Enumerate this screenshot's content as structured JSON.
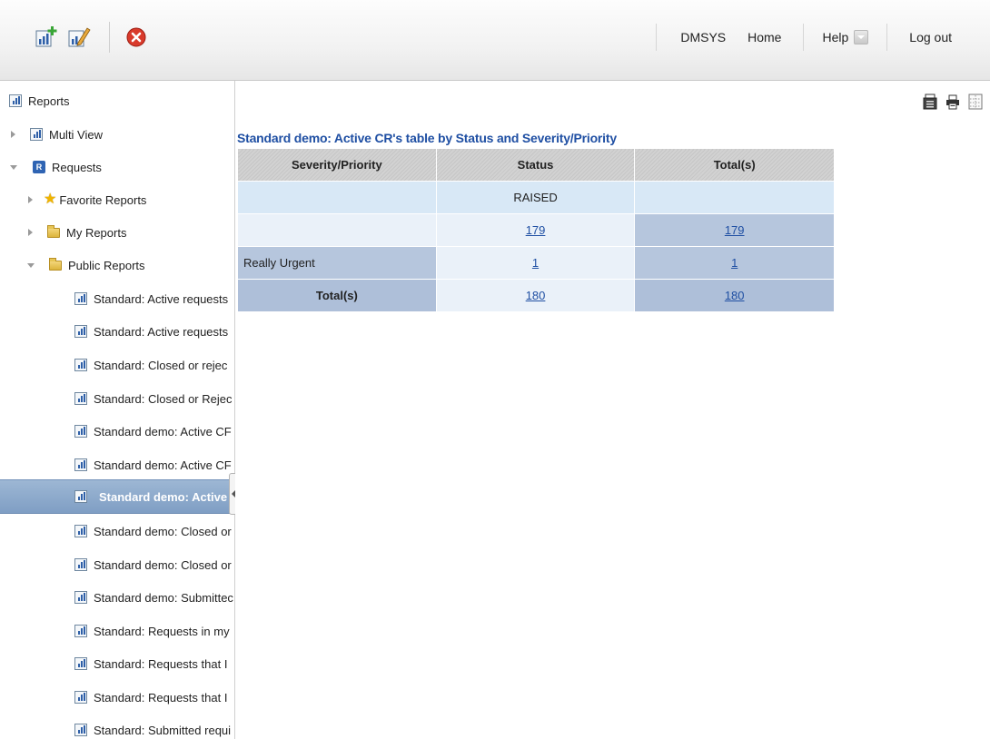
{
  "toolbar": {
    "icons": [
      "new-report-icon",
      "edit-report-icon",
      "delete-icon"
    ]
  },
  "nav": {
    "user": "DMSYS",
    "home": "Home",
    "help": "Help",
    "logout": "Log out"
  },
  "tree": {
    "reports": "Reports",
    "multi_view": "Multi View",
    "requests": "Requests",
    "requests_icon_letter": "R",
    "favorite_reports": "Favorite Reports",
    "my_reports": "My Reports",
    "public_reports": "Public Reports",
    "items": [
      {
        "label": "Standard: Active requests"
      },
      {
        "label": "Standard: Active requests"
      },
      {
        "label": "Standard: Closed or rejec"
      },
      {
        "label": "Standard: Closed or Rejec"
      },
      {
        "label": "Standard demo: Active CF"
      },
      {
        "label": "Standard demo: Active CF"
      },
      {
        "label": "Standard demo: Active"
      },
      {
        "label": "Standard demo: Closed or"
      },
      {
        "label": "Standard demo: Closed or"
      },
      {
        "label": "Standard demo: Submittec"
      },
      {
        "label": "Standard: Requests in my"
      },
      {
        "label": "Standard: Requests that I"
      },
      {
        "label": "Standard: Requests that I"
      },
      {
        "label": "Standard: Submitted requi"
      }
    ],
    "selected_index": 6
  },
  "main": {
    "tools": [
      "export-icon",
      "print-icon",
      "layout-icon"
    ],
    "report_title": "Standard demo: Active CR's table by Status and Severity/Priority",
    "table": {
      "headers": [
        "Severity/Priority",
        "Status",
        "Total(s)"
      ],
      "status_row": [
        "",
        "RAISED",
        ""
      ],
      "rows": [
        {
          "label": "",
          "status": "179",
          "total": "179"
        },
        {
          "label": "Really Urgent",
          "status": "1",
          "total": "1"
        }
      ],
      "totals_row": {
        "label": "Total(s)",
        "status": "180",
        "total": "180"
      }
    }
  },
  "colors": {
    "title_blue": "#1f4fa3",
    "selected_row": "#8aa8cc",
    "header_gray": "#cccccc",
    "cell_light_blue": "#d8e8f6",
    "cell_blue": "#b6c6dd"
  }
}
